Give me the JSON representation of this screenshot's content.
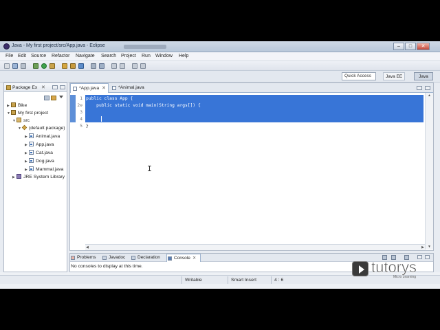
{
  "window": {
    "title": "Java - My first project/src/App.java - Eclipse",
    "controls": [
      "–",
      "□",
      "✕"
    ]
  },
  "menu": [
    "File",
    "Edit",
    "Source",
    "Refactor",
    "Navigate",
    "Search",
    "Project",
    "Run",
    "Window",
    "Help"
  ],
  "toolbar": {
    "quick_access_label": "Quick Access",
    "perspectives": [
      "Java EE",
      "Java"
    ]
  },
  "package_explorer": {
    "title": "Package Ex",
    "tree": [
      {
        "label": "Bike",
        "icon": "project-icon",
        "level": 0,
        "twisty": "▶"
      },
      {
        "label": "My first project",
        "icon": "project-icon",
        "level": 0,
        "twisty": "▼"
      },
      {
        "label": "src",
        "icon": "source-folder-icon",
        "level": 1,
        "twisty": "▼"
      },
      {
        "label": "(default package)",
        "icon": "package-icon",
        "level": 2,
        "twisty": "▼"
      },
      {
        "label": "Animal.java",
        "icon": "java-file-icon",
        "level": 3,
        "twisty": "▶"
      },
      {
        "label": "App.java",
        "icon": "java-file-icon",
        "level": 3,
        "twisty": "▶"
      },
      {
        "label": "Cat.java",
        "icon": "java-file-icon",
        "level": 3,
        "twisty": "▶"
      },
      {
        "label": "Dog.java",
        "icon": "java-file-icon",
        "level": 3,
        "twisty": "▶"
      },
      {
        "label": "Mammal.java",
        "icon": "java-file-icon",
        "level": 3,
        "twisty": "▶"
      },
      {
        "label": "JRE System Library",
        "icon": "library-icon",
        "level": 1,
        "twisty": "▶"
      }
    ]
  },
  "editor": {
    "tabs": [
      {
        "label": "*App.java",
        "active": true
      },
      {
        "label": "*Animal.java",
        "active": false
      }
    ],
    "lines": [
      {
        "num": "1",
        "text": "public class App {",
        "selected": true
      },
      {
        "num": "2⊖",
        "text": "    public static void main(String args[]) {",
        "selected": true
      },
      {
        "num": "3",
        "text": "",
        "selected": true
      },
      {
        "num": "4",
        "text": "",
        "selected": true
      },
      {
        "num": "5",
        "text": "}",
        "selected": false
      }
    ]
  },
  "console": {
    "tabs": [
      "Problems",
      "Javadoc",
      "Declaration",
      "Console"
    ],
    "active_tab": "Console",
    "message": "No consoles to display at this time."
  },
  "status": {
    "writable": "Writable",
    "insert_mode": "Smart Insert",
    "position": "4 : 6"
  },
  "watermark": {
    "brand": "tutorys",
    "tagline": "Micro Learning"
  },
  "colors": {
    "selection": "#3875d7",
    "chrome": "#e3e8ef",
    "titlebar": "#c4d1e1"
  }
}
